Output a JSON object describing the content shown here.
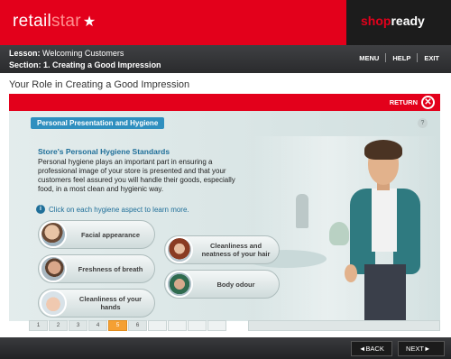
{
  "header": {
    "logo_part1": "retail",
    "logo_part2": "star",
    "logo_star": "★",
    "partner_part1": "shop",
    "partner_part2": "ready"
  },
  "lesson": {
    "lesson_label": "Lesson:",
    "lesson_title": "Welcoming Customers",
    "section_label": "Section:",
    "section_title": "1. Creating a Good Impression"
  },
  "top_nav": {
    "menu": "MENU",
    "help": "HELP",
    "exit": "EXIT"
  },
  "page_title": "Your Role in Creating a Good Impression",
  "return_label": "RETURN",
  "content": {
    "topic_tab": "Personal Presentation and Hygiene",
    "help_symbol": "?",
    "heading": "Store's Personal Hygiene Standards",
    "body": "Personal hygiene plays an important part in ensuring a professional image of your store is presented and that your customers feel assured you will handle their goods, especially food, in a most clean and hygienic way.",
    "hint": "Click on each hygiene aspect to learn more.",
    "aspects": [
      {
        "label": "Facial appearance"
      },
      {
        "label": "Freshness of breath"
      },
      {
        "label": "Cleanliness of your hands"
      },
      {
        "label": "Cleanliness and neatness of your hair"
      },
      {
        "label": "Body odour"
      }
    ]
  },
  "pager": {
    "pages": [
      "1",
      "2",
      "3",
      "4",
      "5",
      "6"
    ],
    "current": "5"
  },
  "footer": {
    "back": "◄BACK",
    "next": "NEXT►"
  },
  "colors": {
    "brand_red": "#e3001b",
    "accent_blue": "#2f8fbf",
    "current_page": "#f5a033"
  }
}
